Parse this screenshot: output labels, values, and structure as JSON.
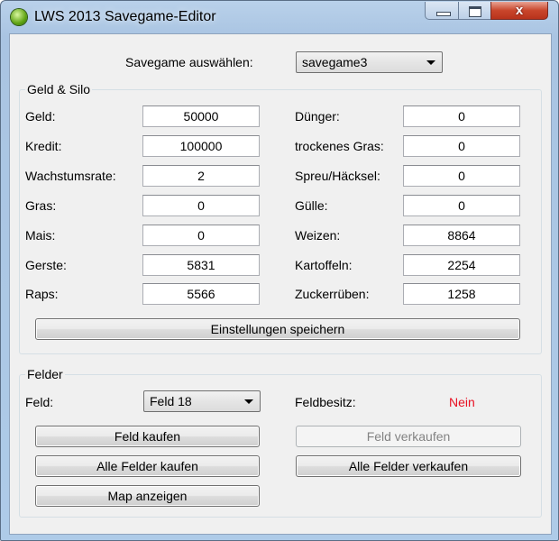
{
  "window": {
    "title": "LWS 2013 Savegame-Editor",
    "close_glyph": "x"
  },
  "savegame": {
    "label": "Savegame auswählen:",
    "selected": "savegame3"
  },
  "geld_silo": {
    "title": "Geld & Silo",
    "left": [
      {
        "label": "Geld:",
        "value": "50000"
      },
      {
        "label": "Kredit:",
        "value": "100000"
      },
      {
        "label": "Wachstumsrate:",
        "value": "2"
      },
      {
        "label": "Gras:",
        "value": "0"
      },
      {
        "label": "Mais:",
        "value": "0"
      },
      {
        "label": "Gerste:",
        "value": "5831"
      },
      {
        "label": "Raps:",
        "value": "5566"
      }
    ],
    "right": [
      {
        "label": "Dünger:",
        "value": "0"
      },
      {
        "label": "trockenes Gras:",
        "value": "0"
      },
      {
        "label": "Spreu/Häcksel:",
        "value": "0"
      },
      {
        "label": "Gülle:",
        "value": "0"
      },
      {
        "label": "Weizen:",
        "value": "8864"
      },
      {
        "label": "Kartoffeln:",
        "value": "2254"
      },
      {
        "label": "Zuckerrüben:",
        "value": "1258"
      }
    ],
    "save_button": "Einstellungen speichern"
  },
  "felder": {
    "title": "Felder",
    "feld_label": "Feld:",
    "feld_selected": "Feld 18",
    "besitz_label": "Feldbesitz:",
    "besitz_value": "Nein",
    "besitz_color": "#e81123",
    "buttons": {
      "feld_kaufen": "Feld kaufen",
      "feld_verkaufen": "Feld verkaufen",
      "alle_kaufen": "Alle Felder kaufen",
      "alle_verkaufen": "Alle Felder verkaufen",
      "map": "Map anzeigen"
    }
  }
}
